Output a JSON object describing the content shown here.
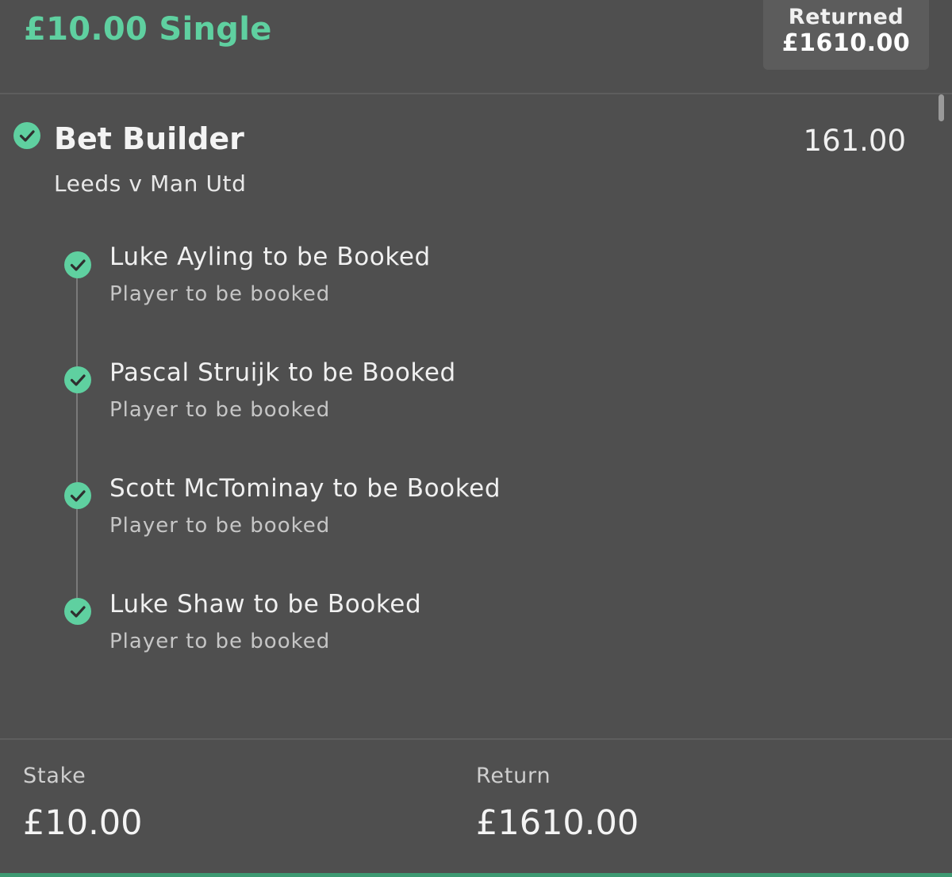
{
  "header": {
    "bet_title": "£10.00 Single",
    "returned_label": "Returned",
    "returned_amount": "£1610.00"
  },
  "selection": {
    "market": "Bet Builder",
    "odds": "161.00",
    "event": "Leeds v Man Utd",
    "status_icon": "check-circle-icon",
    "legs": [
      {
        "title": "Luke Ayling to be Booked",
        "market": "Player to be booked"
      },
      {
        "title": "Pascal Struijk to be Booked",
        "market": "Player to be booked"
      },
      {
        "title": "Scott McTominay to be Booked",
        "market": "Player to be booked"
      },
      {
        "title": "Luke Shaw to be Booked",
        "market": "Player to be booked"
      }
    ]
  },
  "footer": {
    "stake_label": "Stake",
    "stake_value": "£10.00",
    "return_label": "Return",
    "return_value": "£1610.00"
  },
  "colors": {
    "accent_green": "#5fd0a0",
    "background": "#4f4f4f"
  }
}
